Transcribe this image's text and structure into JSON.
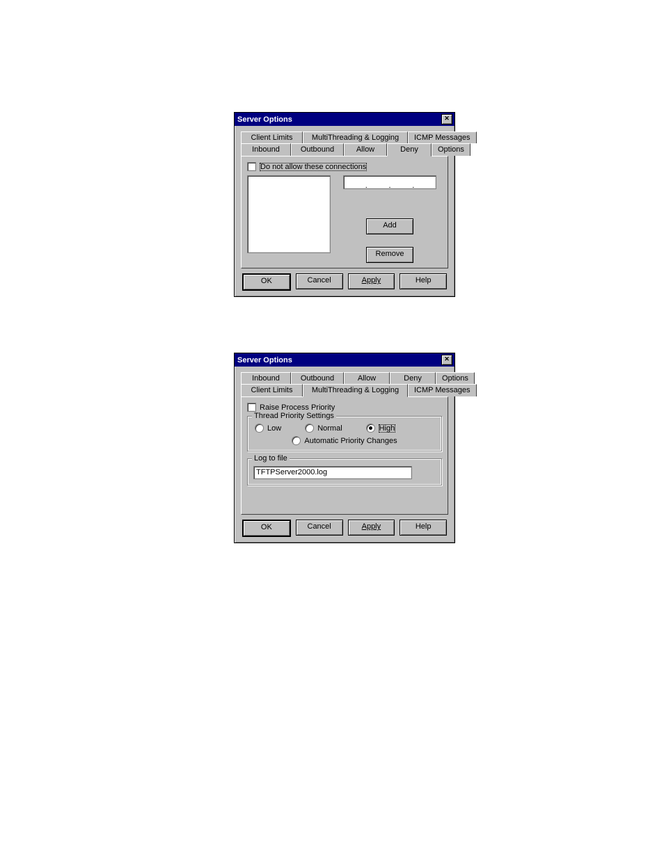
{
  "dialog1": {
    "title": "Server Options",
    "close_glyph": "✕",
    "tabs_row1": [
      "Client Limits",
      "MultiThreading & Logging",
      "ICMP Messages"
    ],
    "tabs_row2": [
      "Inbound",
      "Outbound",
      "Allow",
      "Deny",
      "Options"
    ],
    "active_tab": "Deny",
    "checkbox_label": "Do not allow these connections",
    "checkbox_checked": false,
    "ip_value": ".   .   .",
    "add_label": "Add",
    "remove_label": "Remove",
    "buttons": {
      "ok": "OK",
      "cancel": "Cancel",
      "apply": "Apply",
      "help": "Help"
    }
  },
  "dialog2": {
    "title": "Server Options",
    "close_glyph": "✕",
    "tabs_row1": [
      "Inbound",
      "Outbound",
      "Allow",
      "Deny",
      "Options"
    ],
    "tabs_row2": [
      "Client Limits",
      "MultiThreading & Logging",
      "ICMP Messages"
    ],
    "active_tab": "MultiThreading & Logging",
    "raise_priority_label": "Raise Process Priority",
    "raise_priority_checked": false,
    "thread_group_label": "Thread Priority Settings",
    "radio_low": "Low",
    "radio_normal": "Normal",
    "radio_high": "High",
    "radio_auto": "Automatic Priority Changes",
    "selected_priority": "High",
    "log_group_label": "Log to file",
    "log_file_value": "TFTPServer2000.log",
    "buttons": {
      "ok": "OK",
      "cancel": "Cancel",
      "apply": "Apply",
      "help": "Help"
    }
  }
}
